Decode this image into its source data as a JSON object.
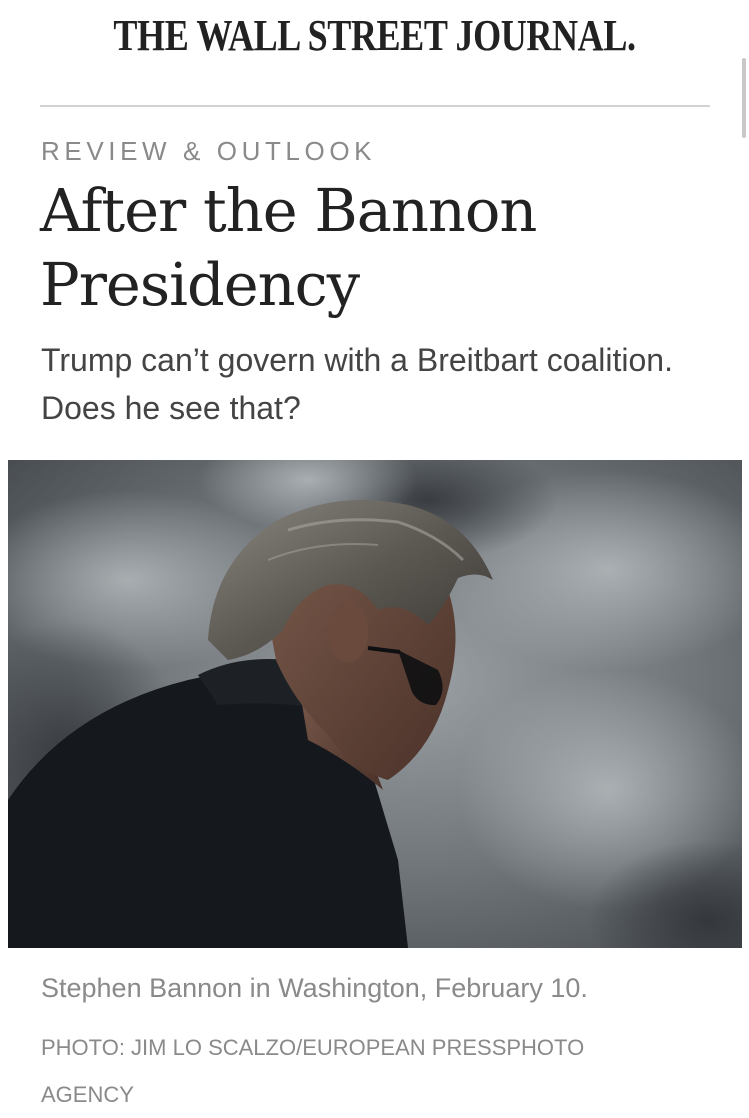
{
  "header": {
    "masthead": "THE WALL STREET JOURNAL."
  },
  "article": {
    "section": "REVIEW & OUTLOOK",
    "headline": "After the Bannon Presidency",
    "dek": "Trump can’t govern with a Breitbart coalition. Does he see that?",
    "photo_caption": "Stephen Bannon in Washington, February 10.",
    "photo_credit": "PHOTO: JIM LO SCALZO/EUROPEAN PRESSPHOTO AGENCY"
  },
  "colors": {
    "text": "#222222",
    "muted": "#8a8a8a",
    "divider": "#d2d2d2"
  }
}
